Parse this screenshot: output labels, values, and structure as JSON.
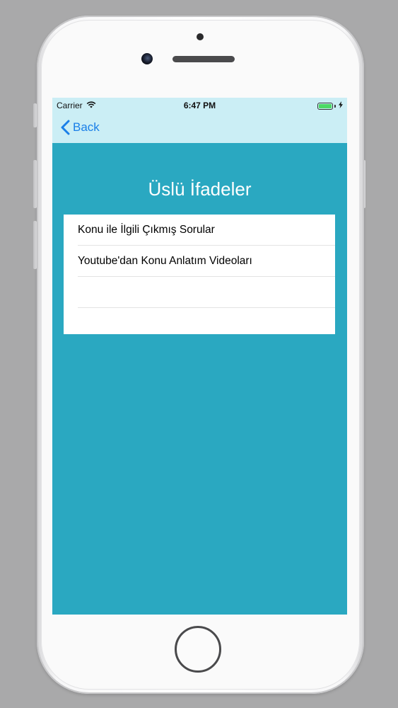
{
  "status_bar": {
    "carrier": "Carrier",
    "time": "6:47 PM",
    "battery_level": 1.0
  },
  "nav": {
    "back_label": "Back"
  },
  "page": {
    "title": "Üslü İfadeler"
  },
  "list": {
    "items": [
      {
        "label": "Konu ile İlgili Çıkmış Sorular"
      },
      {
        "label": "Youtube'dan Konu Anlatım Videoları"
      }
    ]
  },
  "colors": {
    "screen_background": "#2aa8c1",
    "nav_background": "#cbeef5",
    "accent": "#1a7fe8",
    "battery": "#4cd964"
  },
  "icons": {
    "wifi": "wifi-icon",
    "back": "chevron-left-icon",
    "battery": "battery-icon",
    "charging": "bolt-icon"
  }
}
